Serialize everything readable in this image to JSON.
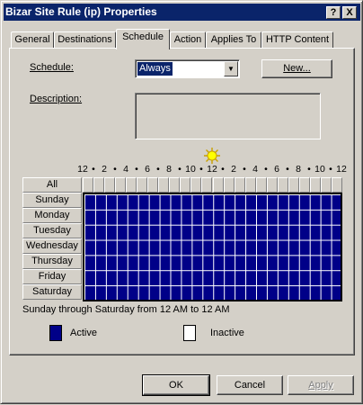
{
  "window": {
    "title": "Bizar Site Rule (ip) Properties"
  },
  "titlebar_buttons": {
    "help": "?",
    "close": "X"
  },
  "tabs": [
    {
      "label": "General"
    },
    {
      "label": "Destinations"
    },
    {
      "label": "Schedule"
    },
    {
      "label": "Action"
    },
    {
      "label": "Applies To"
    },
    {
      "label": "HTTP Content"
    }
  ],
  "active_tab": "Schedule",
  "schedule": {
    "label": "Schedule:",
    "value": "Always",
    "new_button": "New..."
  },
  "description": {
    "label": "Description:",
    "value": ""
  },
  "timeline": {
    "hours": [
      "12",
      "2",
      "4",
      "6",
      "8",
      "10",
      "12",
      "2",
      "4",
      "6",
      "8",
      "10",
      "12"
    ],
    "separator": "•",
    "icons": [
      "moon-icon",
      "sun-icon",
      "moon-icon"
    ]
  },
  "grid": {
    "all_label": "All",
    "days": [
      "Sunday",
      "Monday",
      "Tuesday",
      "Wednesday",
      "Thursday",
      "Friday",
      "Saturday"
    ],
    "hour_columns": 24,
    "active_color": "#000088",
    "inactive_color": "#ffffff"
  },
  "summary": "Sunday through Saturday from 12 AM to 12 AM",
  "legend": {
    "active": "Active",
    "inactive": "Inactive"
  },
  "buttons": {
    "ok": "OK",
    "cancel": "Cancel",
    "apply": "Apply"
  }
}
